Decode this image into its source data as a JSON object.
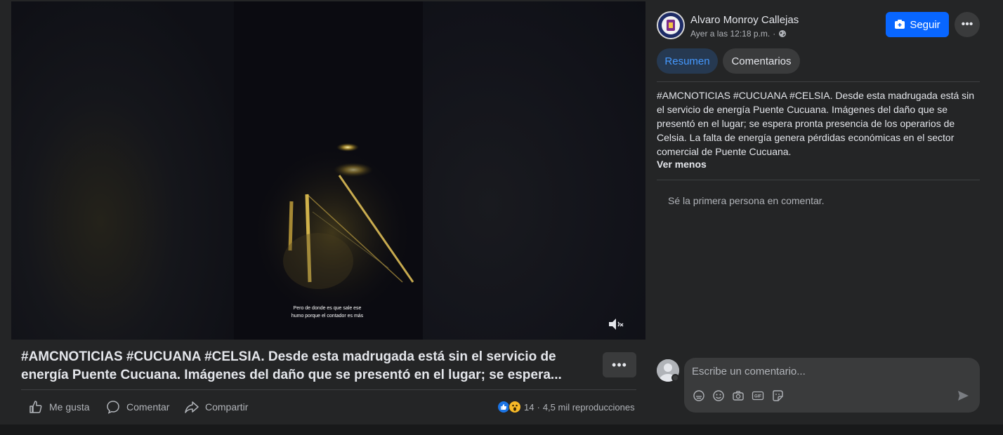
{
  "video": {
    "caption_line1": "Pero de donde es que sale ese",
    "caption_line2": "humo porque el contador es más",
    "mute_icon": "mute-icon"
  },
  "post": {
    "title_line1": "#AMCNOTICIAS #CUCUANA #CELSIA. Desde esta madrugada está sin el servicio de",
    "title_line2": "energía Puente Cucuana. Imágenes del daño que se presentó en el lugar; se espera...",
    "more_label": "•••"
  },
  "actions": {
    "like": "Me gusta",
    "comment": "Comentar",
    "share": "Compartir"
  },
  "stats": {
    "reactions_count": "14",
    "separator": "·",
    "views": "4,5 mil reproducciones"
  },
  "author": {
    "name": "Alvaro Monroy Callejas",
    "time": "Ayer a las 12:18 p.m.",
    "dot": "·"
  },
  "header": {
    "follow_label": "Seguir",
    "more_label": "•••"
  },
  "tabs": [
    {
      "label": "Resumen",
      "active": true
    },
    {
      "label": "Comentarios",
      "active": false
    }
  ],
  "description": {
    "tags": "#AMCNOTICIAS #CUCUANA #CELSIA.",
    "text": " Desde esta madrugada está sin el servicio de energía Puente Cucuana. Imágenes del daño que se presentó en el lugar; se espera pronta presencia de los operarios de Celsia. La falta de energía genera pérdidas económicas en el sector comercial de Puente Cucuana.",
    "toggle": "Ver menos"
  },
  "comments": {
    "empty_message": "Sé la primera persona en comentar.",
    "placeholder": "Escribe un comentario..."
  },
  "colors": {
    "accent": "#0866ff",
    "panel_bg": "#242526",
    "page_bg": "#18191a",
    "tab_active_bg": "#263951",
    "tab_active_text": "#4599ff"
  }
}
